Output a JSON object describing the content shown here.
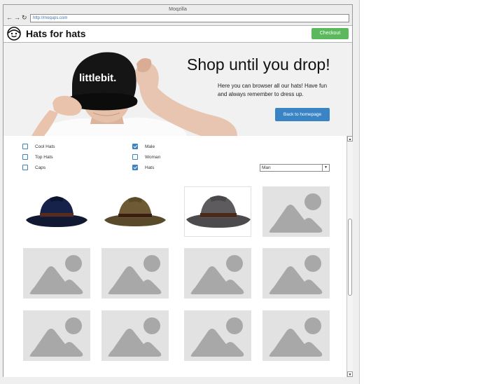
{
  "window": {
    "title": "Moqzilla",
    "url": "http://moqups.com"
  },
  "header": {
    "brand": "Hats for hats",
    "checkout_label": "Checkout",
    "logo_icon": "face-icon"
  },
  "hero": {
    "logo_text": "littlebit.",
    "title": "Shop until you drop!",
    "text": "Here you can browser all our hats! Have fun and always remember to dress up.",
    "button_label": "Back to homepage"
  },
  "filters": [
    {
      "label": "Cool Hats",
      "checked": false
    },
    {
      "label": "Top Hats",
      "checked": false
    },
    {
      "label": "Caps",
      "checked": false
    },
    {
      "label": "Male",
      "checked": true
    },
    {
      "label": "Woman",
      "checked": false
    },
    {
      "label": "Hats",
      "checked": true
    }
  ],
  "sort_select": {
    "value": "Man"
  },
  "products": [
    {
      "kind": "hat",
      "icon": "navy-fedora-image"
    },
    {
      "kind": "hat",
      "icon": "brown-fedora-image"
    },
    {
      "kind": "hat",
      "icon": "gray-fedora-image"
    },
    {
      "kind": "placeholder",
      "icon": "image-placeholder-icon"
    },
    {
      "kind": "placeholder",
      "icon": "image-placeholder-icon"
    },
    {
      "kind": "placeholder",
      "icon": "image-placeholder-icon"
    },
    {
      "kind": "placeholder",
      "icon": "image-placeholder-icon"
    },
    {
      "kind": "placeholder",
      "icon": "image-placeholder-icon"
    },
    {
      "kind": "placeholder",
      "icon": "image-placeholder-icon"
    },
    {
      "kind": "placeholder",
      "icon": "image-placeholder-icon"
    },
    {
      "kind": "placeholder",
      "icon": "image-placeholder-icon"
    },
    {
      "kind": "placeholder",
      "icon": "image-placeholder-icon"
    }
  ],
  "colors": {
    "accent": "#3a84c6",
    "checkout": "#5cb85c",
    "placeholder": "#e2e2e2",
    "placeholder_shape": "#a8a8a8"
  }
}
